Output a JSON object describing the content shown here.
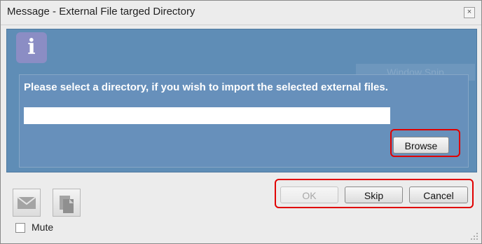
{
  "window": {
    "title": "Message - External File targed Directory",
    "close_glyph": "×"
  },
  "info_icon": {
    "glyph": "i",
    "icon": "info-icon"
  },
  "snip_overlay": {
    "label": "Window Snip"
  },
  "prompt": {
    "text": "Please select a directory, if you wish to import the selected external files."
  },
  "directory_input": {
    "value": "",
    "placeholder": ""
  },
  "buttons": {
    "browse": "Browse",
    "ok": "OK",
    "skip": "Skip",
    "cancel": "Cancel"
  },
  "mute": {
    "label": "Mute",
    "checked": false
  },
  "icons": {
    "mail": "mail-icon",
    "copy": "copy-icon"
  },
  "colors": {
    "panel": "#5f8db6",
    "highlight": "#e00000",
    "accent_icon": "#8b8dc4"
  }
}
